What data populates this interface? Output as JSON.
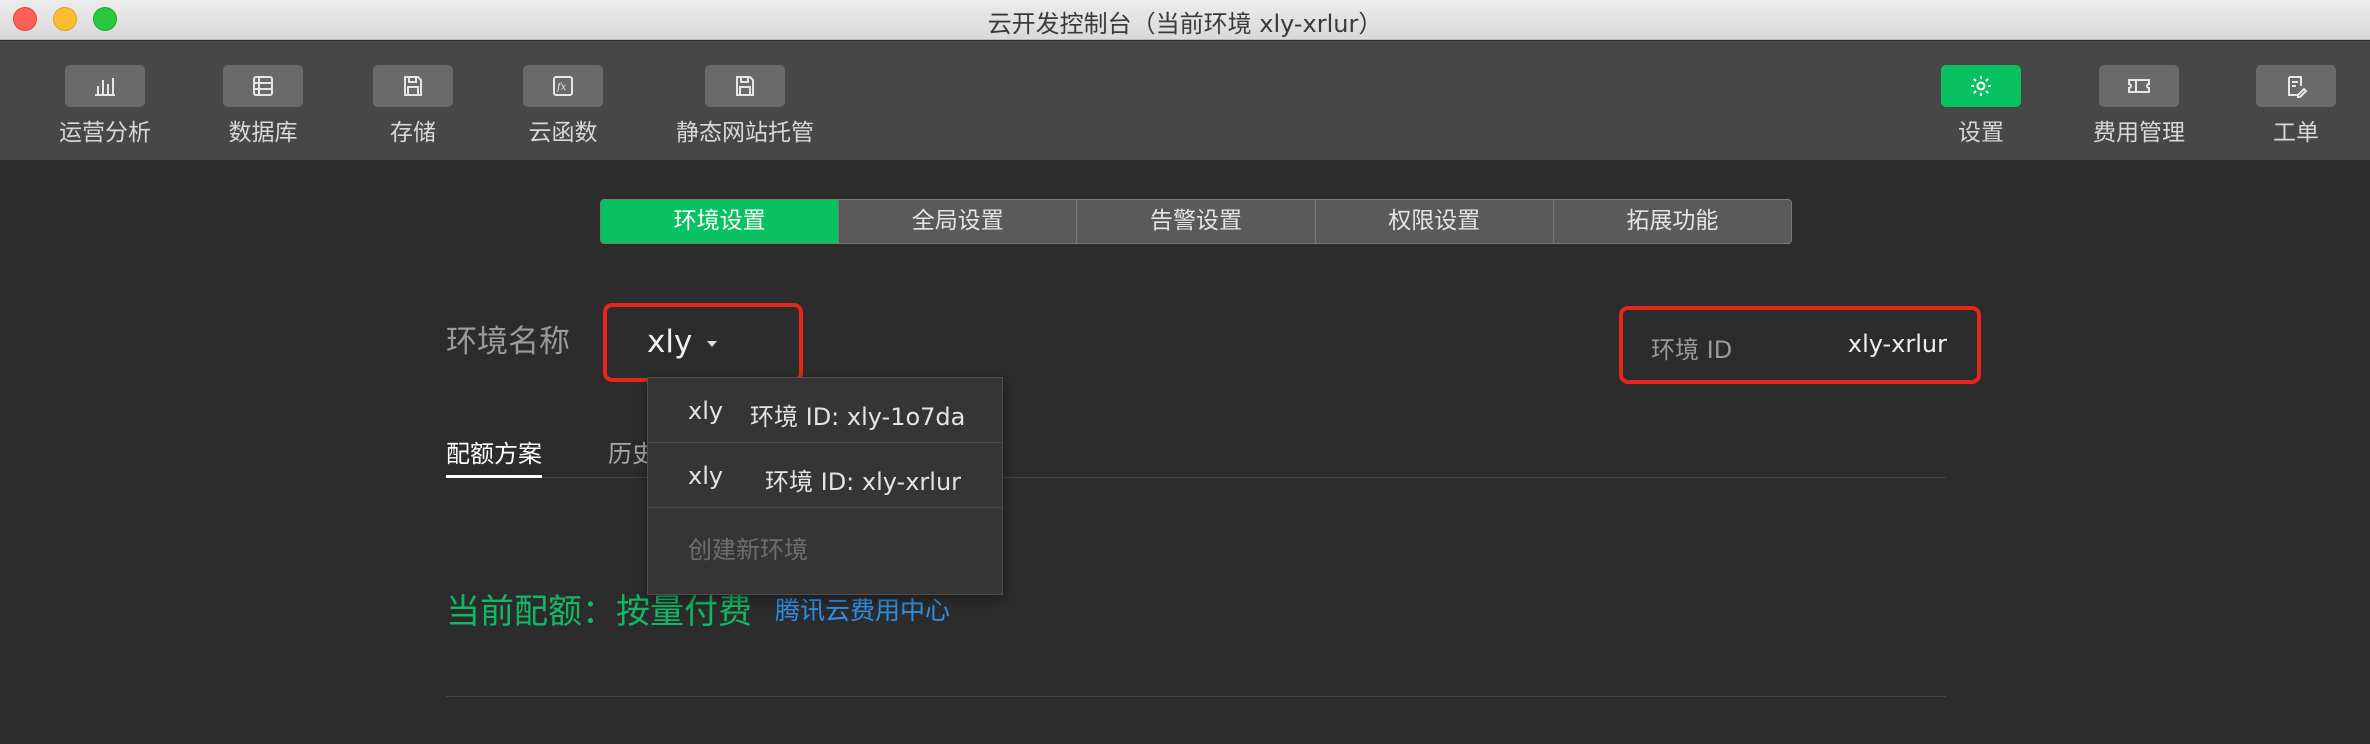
{
  "window": {
    "title": "云开发控制台（当前环境 xly-xrlur）"
  },
  "toolbar": {
    "left": [
      {
        "label": "运营分析",
        "icon": "bar-chart-icon"
      },
      {
        "label": "数据库",
        "icon": "database-icon"
      },
      {
        "label": "存储",
        "icon": "storage-icon"
      },
      {
        "label": "云函数",
        "icon": "function-icon"
      },
      {
        "label": "静态网站托管",
        "icon": "hosting-icon"
      }
    ],
    "right": [
      {
        "label": "设置",
        "icon": "gear-icon",
        "active": true
      },
      {
        "label": "费用管理",
        "icon": "ticket-icon"
      },
      {
        "label": "工单",
        "icon": "ticket-edit-icon"
      }
    ]
  },
  "tabs": {
    "items": [
      "环境设置",
      "全局设置",
      "告警设置",
      "权限设置",
      "拓展功能"
    ],
    "active": "环境设置"
  },
  "env": {
    "label": "环境名称",
    "selected": "xly",
    "id_label": "环境 ID",
    "id_value": "xly-xrlur"
  },
  "subtabs": {
    "items": [
      "配额方案",
      "历史"
    ],
    "active": "配额方案"
  },
  "quota": {
    "text": "当前配额：按量付费",
    "link": "腾讯云费用中心"
  },
  "dropdown": {
    "items": [
      {
        "name": "xly",
        "id_text": "环境 ID: xly-1o7da"
      },
      {
        "name": "xly",
        "id_text": "环境 ID: xly-xrlur"
      }
    ],
    "create_label": "创建新环境"
  },
  "colors": {
    "accent": "#08c160",
    "highlight": "#e8251a",
    "link": "#2f8fe6"
  }
}
